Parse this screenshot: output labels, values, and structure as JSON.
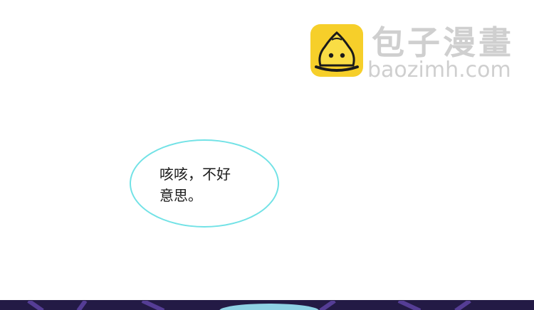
{
  "watermark": {
    "icon": "bun-logo-icon",
    "title_cn": "包子漫畫",
    "site": "baozimh.com",
    "accent": "#f6cf2a"
  },
  "speech_bubble": {
    "line1": "咳咳，不好",
    "line2": "意思。",
    "border_color": "#72e2e6"
  },
  "bottom_scene": {
    "band_color": "#231a45",
    "glow_color": "#9ae6f5"
  }
}
